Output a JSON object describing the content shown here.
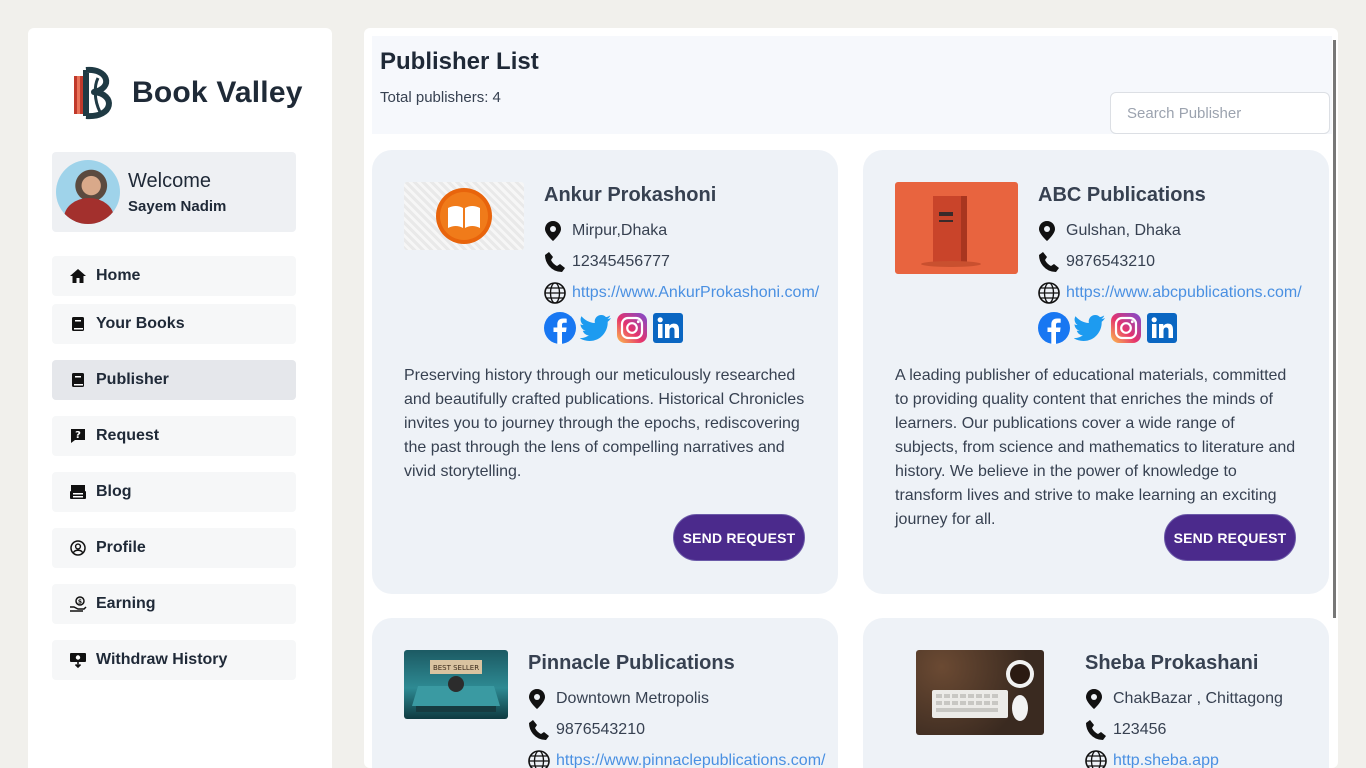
{
  "brand": {
    "name": "Book Valley"
  },
  "welcome": {
    "title": "Welcome",
    "user": "Sayem Nadim"
  },
  "nav": [
    {
      "label": "Home",
      "icon": "home-icon"
    },
    {
      "label": "Your Books",
      "icon": "book-icon"
    },
    {
      "label": "Publisher",
      "icon": "book-icon",
      "active": true
    },
    {
      "label": "Request",
      "icon": "question-icon"
    },
    {
      "label": "Blog",
      "icon": "blog-icon"
    },
    {
      "label": "Profile",
      "icon": "user-circle-icon"
    },
    {
      "label": "Earning",
      "icon": "hand-coin-icon"
    },
    {
      "label": "Withdraw History",
      "icon": "withdraw-icon"
    }
  ],
  "header": {
    "title": "Publisher List",
    "total_label": "Total publishers: 4",
    "search_placeholder": "Search Publisher"
  },
  "publishers": [
    {
      "name": "Ankur Prokashoni",
      "address": "Mirpur,Dhaka",
      "phone": "12345456777",
      "website": "https://www.AnkurProkashoni.com/",
      "description": "Preserving history through our meticulously researched and beautifully crafted publications. Historical Chronicles invites you to journey through the epochs, rediscovering the past through the lens of compelling narratives and vivid storytelling.",
      "button": "SEND REQUEST"
    },
    {
      "name": "ABC Publications",
      "address": "Gulshan, Dhaka",
      "phone": "9876543210",
      "website": "https://www.abcpublications.com/",
      "description": "A leading publisher of educational materials, committed to providing quality content that enriches the minds of learners. Our publications cover a wide range of subjects, from science and mathematics to literature and history. We believe in the power of knowledge to transform lives and strive to make learning an exciting journey for all.",
      "button": "SEND REQUEST"
    },
    {
      "name": "Pinnacle Publications",
      "address": "Downtown Metropolis",
      "phone": "9876543210",
      "website": "https://www.pinnaclepublications.com/"
    },
    {
      "name": "Sheba Prokashani",
      "address": "ChakBazar , Chittagong",
      "phone": "123456",
      "website": "http.sheba.app"
    }
  ],
  "colors": {
    "accent": "#4b2a8c",
    "link": "#4a90e2",
    "card": "#eef2f7"
  }
}
